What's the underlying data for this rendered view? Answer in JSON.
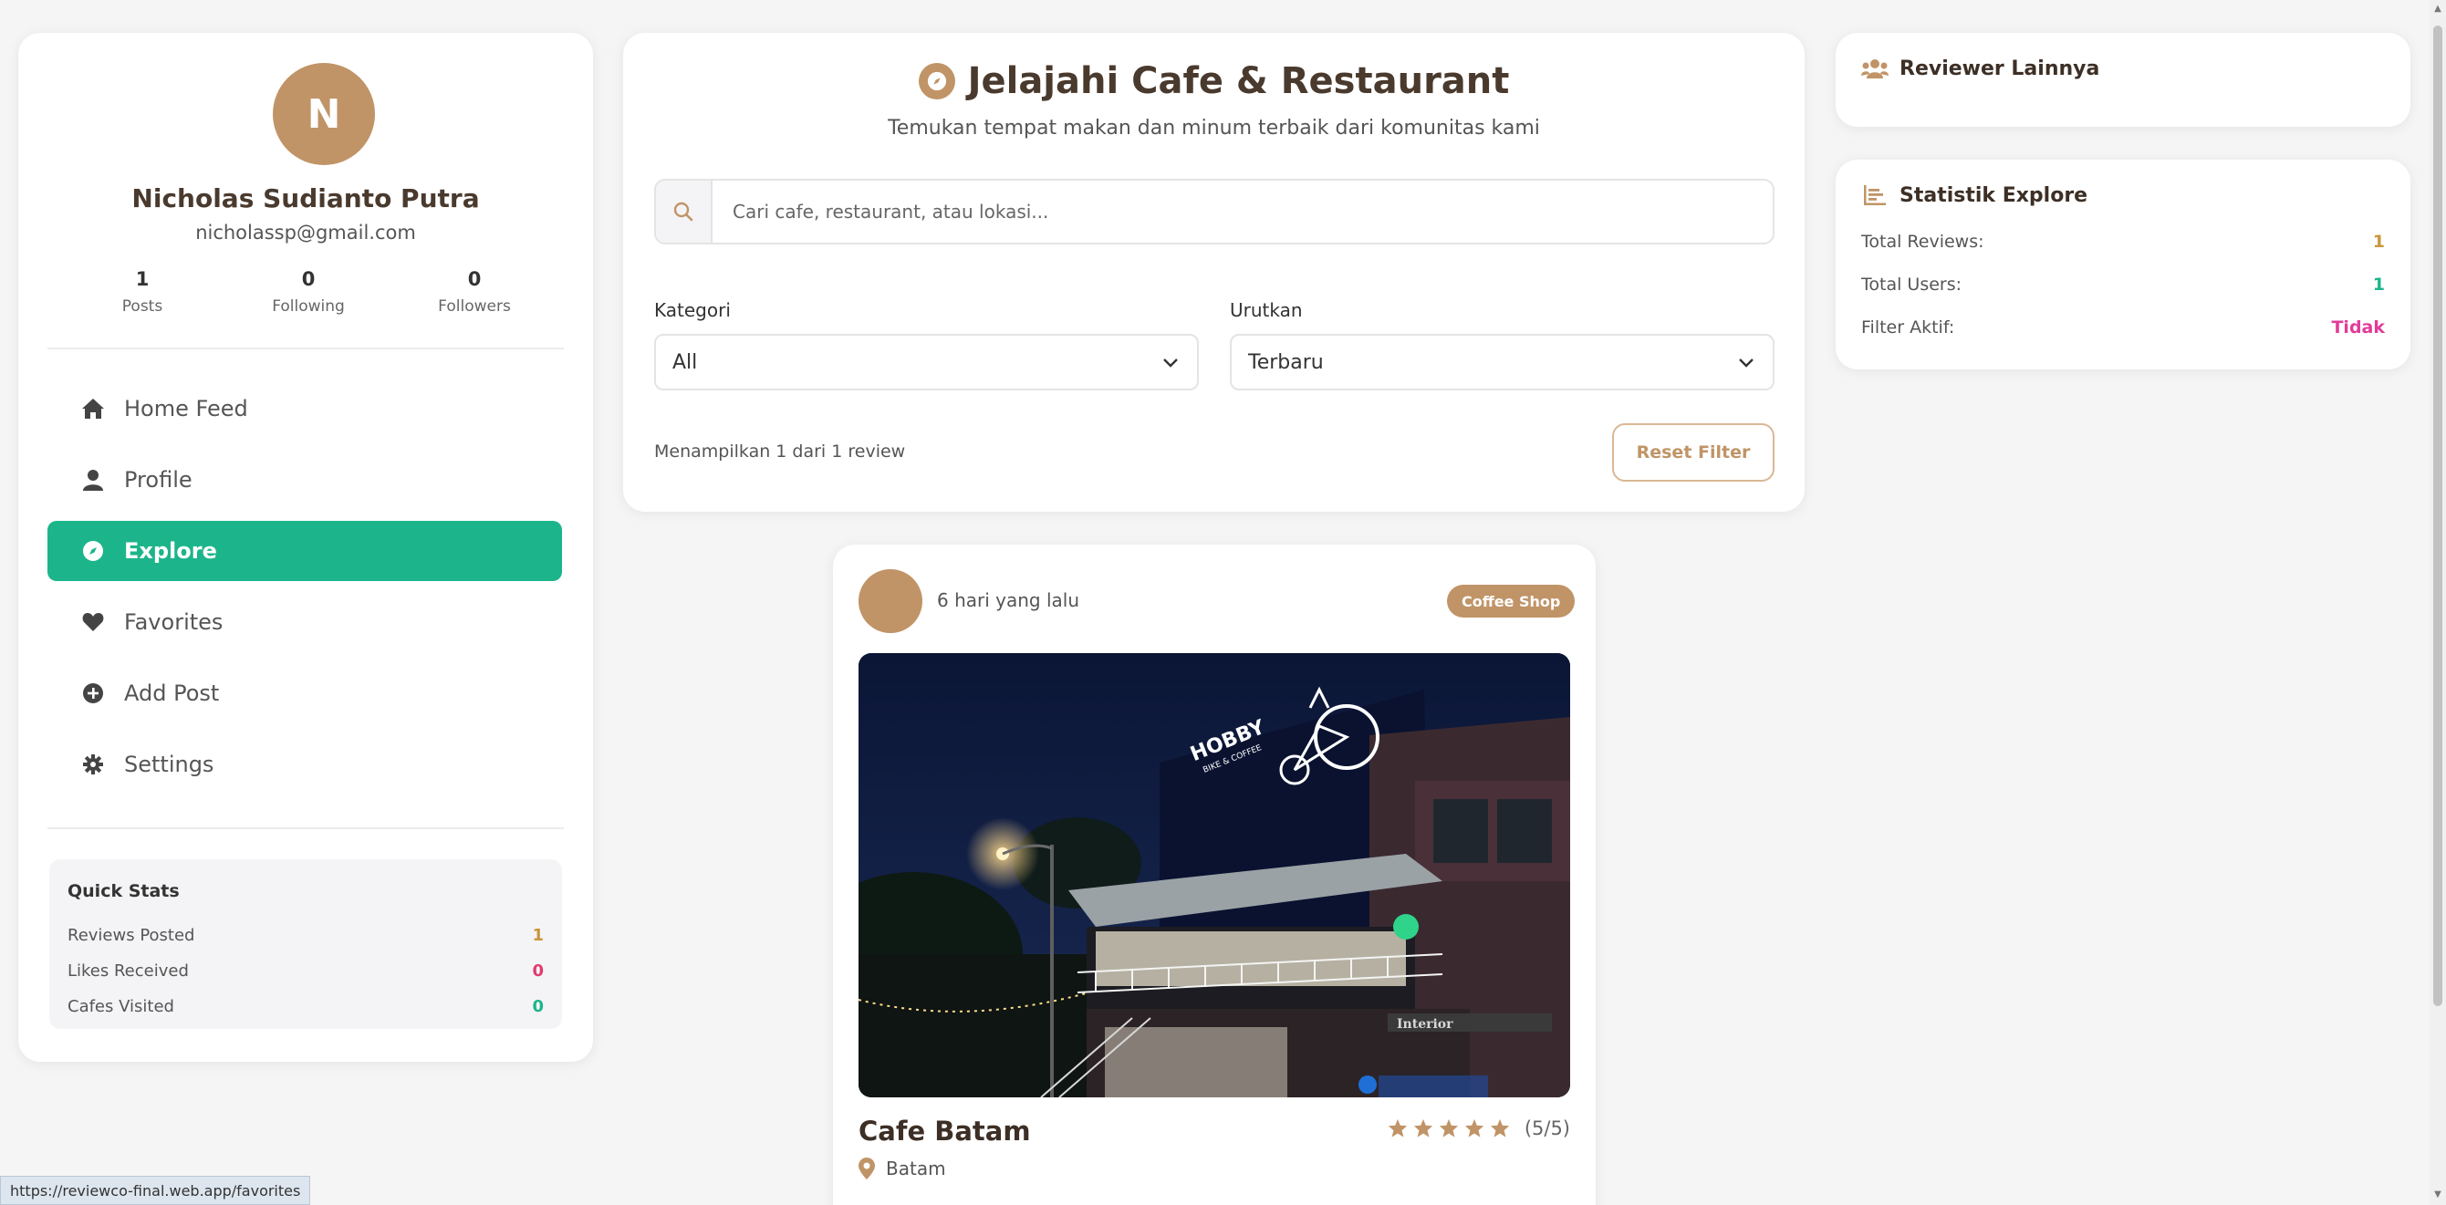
{
  "user": {
    "initial": "N",
    "name": "Nicholas Sudianto Putra",
    "email": "nicholassp@gmail.com",
    "stats": [
      {
        "value": "1",
        "label": "Posts"
      },
      {
        "value": "0",
        "label": "Following"
      },
      {
        "value": "0",
        "label": "Followers"
      }
    ]
  },
  "nav": {
    "items": [
      {
        "label": "Home Feed",
        "icon": "home-icon"
      },
      {
        "label": "Profile",
        "icon": "user-icon"
      },
      {
        "label": "Explore",
        "icon": "compass-icon",
        "active": true
      },
      {
        "label": "Favorites",
        "icon": "heart-icon"
      },
      {
        "label": "Add Post",
        "icon": "plus-circle-icon"
      },
      {
        "label": "Settings",
        "icon": "gear-icon"
      }
    ]
  },
  "quick_stats": {
    "title": "Quick Stats",
    "rows": [
      {
        "label": "Reviews Posted",
        "value": "1",
        "color": "#c8963c"
      },
      {
        "label": "Likes Received",
        "value": "0",
        "color": "#e23b6e"
      },
      {
        "label": "Cafes Visited",
        "value": "0",
        "color": "#1cb58b"
      }
    ]
  },
  "explore": {
    "title": "Jelajahi Cafe & Restaurant",
    "subtitle": "Temukan tempat makan dan minum terbaik dari komunitas kami",
    "search_placeholder": "Cari cafe, restaurant, atau lokasi...",
    "category_label": "Kategori",
    "category_value": "All",
    "sort_label": "Urutkan",
    "sort_value": "Terbaru",
    "result_text": "Menampilkan 1 dari 1 review",
    "reset_label": "Reset Filter"
  },
  "review": {
    "time": "6 hari yang lalu",
    "badge": "Coffee Shop",
    "title": "Cafe Batam",
    "rating": 5,
    "rating_text": "(5/5)",
    "location": "Batam",
    "image_sign": "HOBBY",
    "image_sign_sub": "BIKE & COFFEE",
    "image_banner": "Interior"
  },
  "right": {
    "reviewers_title": "Reviewer Lainnya",
    "stats_title": "Statistik Explore",
    "rows": [
      {
        "label": "Total Reviews:",
        "value": "1",
        "color": "#c8963c"
      },
      {
        "label": "Total Users:",
        "value": "1",
        "color": "#1cb58b"
      },
      {
        "label": "Filter Aktif:",
        "value": "Tidak",
        "color": "#e23b9a"
      }
    ]
  },
  "status_url": "https://reviewco-final.web.app/favorites",
  "colors": {
    "accent": "#1cb58b",
    "brand": "#c09467"
  }
}
